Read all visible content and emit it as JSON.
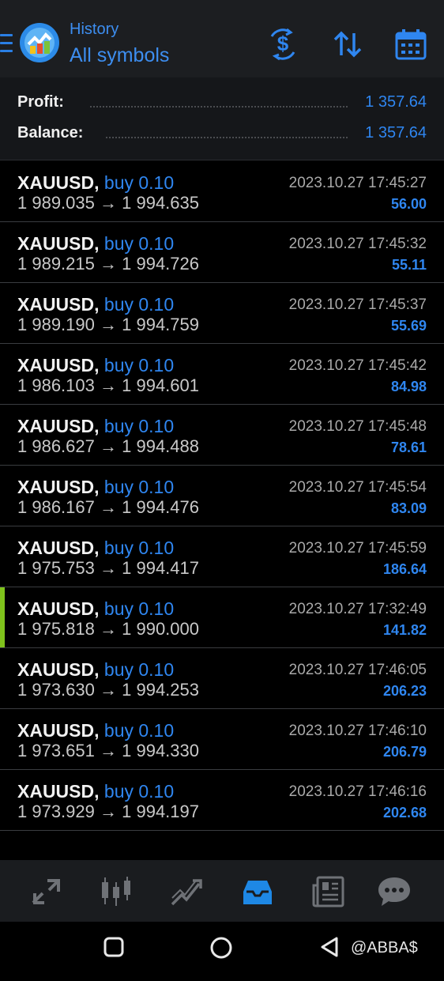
{
  "header": {
    "subtitle": "History",
    "title": "All symbols"
  },
  "summary": {
    "profit_label": "Profit:",
    "profit_value": "1 357.64",
    "balance_label": "Balance:",
    "balance_value": "1 357.64"
  },
  "deals": [
    {
      "symbol": "XAUUSD,",
      "type": "buy 0.10",
      "open": "1 989.035",
      "arrow": "→",
      "close": "1 994.635",
      "time": "2023.10.27 17:45:27",
      "profit": "56.00",
      "marked": false
    },
    {
      "symbol": "XAUUSD,",
      "type": "buy 0.10",
      "open": "1 989.215",
      "arrow": "→",
      "close": "1 994.726",
      "time": "2023.10.27 17:45:32",
      "profit": "55.11",
      "marked": false
    },
    {
      "symbol": "XAUUSD,",
      "type": "buy 0.10",
      "open": "1 989.190",
      "arrow": "→",
      "close": "1 994.759",
      "time": "2023.10.27 17:45:37",
      "profit": "55.69",
      "marked": false
    },
    {
      "symbol": "XAUUSD,",
      "type": "buy 0.10",
      "open": "1 986.103",
      "arrow": "→",
      "close": "1 994.601",
      "time": "2023.10.27 17:45:42",
      "profit": "84.98",
      "marked": false
    },
    {
      "symbol": "XAUUSD,",
      "type": "buy 0.10",
      "open": "1 986.627",
      "arrow": "→",
      "close": "1 994.488",
      "time": "2023.10.27 17:45:48",
      "profit": "78.61",
      "marked": false
    },
    {
      "symbol": "XAUUSD,",
      "type": "buy 0.10",
      "open": "1 986.167",
      "arrow": "→",
      "close": "1 994.476",
      "time": "2023.10.27 17:45:54",
      "profit": "83.09",
      "marked": false
    },
    {
      "symbol": "XAUUSD,",
      "type": "buy 0.10",
      "open": "1 975.753",
      "arrow": "→",
      "close": "1 994.417",
      "time": "2023.10.27 17:45:59",
      "profit": "186.64",
      "marked": false
    },
    {
      "symbol": "XAUUSD,",
      "type": "buy 0.10",
      "open": "1 975.818",
      "arrow": "→",
      "close": "1 990.000",
      "time": "2023.10.27 17:32:49",
      "profit": "141.82",
      "marked": true
    },
    {
      "symbol": "XAUUSD,",
      "type": "buy 0.10",
      "open": "1 973.630",
      "arrow": "→",
      "close": "1 994.253",
      "time": "2023.10.27 17:46:05",
      "profit": "206.23",
      "marked": false
    },
    {
      "symbol": "XAUUSD,",
      "type": "buy 0.10",
      "open": "1 973.651",
      "arrow": "→",
      "close": "1 994.330",
      "time": "2023.10.27 17:46:10",
      "profit": "206.79",
      "marked": false
    },
    {
      "symbol": "XAUUSD,",
      "type": "buy 0.10",
      "open": "1 973.929",
      "arrow": "→",
      "close": "1 994.197",
      "time": "2023.10.27 17:46:16",
      "profit": "202.68",
      "marked": false
    }
  ],
  "icons": {
    "header": [
      "menu-icon",
      "app-logo-icon",
      "currency-exchange-icon",
      "sort-icon",
      "calendar-icon"
    ],
    "tabs": [
      "quotes-icon",
      "chart-icon",
      "trade-icon",
      "history-icon",
      "news-icon",
      "chat-icon"
    ],
    "nav": [
      "recent-apps-icon",
      "home-icon",
      "back-icon"
    ]
  },
  "colors": {
    "accent": "#2f86f0",
    "active_tab": "#1e88e5",
    "marker": "#7fc21c",
    "background": "#000000"
  },
  "watermark": "@ABBA$"
}
